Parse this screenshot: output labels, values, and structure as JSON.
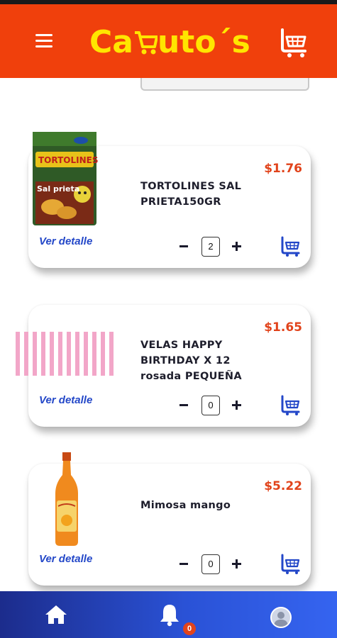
{
  "header": {
    "logo_text_1": "Ca",
    "logo_text_2": "uto´s",
    "menu_icon": "hamburger-menu-icon",
    "cart_icon": "shopping-cart-icon"
  },
  "colors": {
    "header_bg": "#f0400c",
    "logo": "#ffe600",
    "price": "#e1431b",
    "link": "#2347c8",
    "nav_gradient_start": "#1c2c8c",
    "nav_gradient_end": "#3564f0"
  },
  "products": [
    {
      "name": "TORTOLINES SAL PRIETA150GR",
      "price": "$1.76",
      "detail_label": "Ver detalle",
      "quantity": "2",
      "image_label": "TORTOLINES",
      "image_sub": "Sal prieta"
    },
    {
      "name": "VELAS HAPPY BIRTHDAY X 12 rosada PEQUEÑA",
      "price": "$1.65",
      "detail_label": "Ver detalle",
      "quantity": "0"
    },
    {
      "name": "Mimosa mango",
      "price": "$5.22",
      "detail_label": "Ver detalle",
      "quantity": "0"
    }
  ],
  "bottom_nav": {
    "home_icon": "home-icon",
    "bell_icon": "bell-icon",
    "notification_count": "0",
    "profile_icon": "avatar-icon"
  }
}
